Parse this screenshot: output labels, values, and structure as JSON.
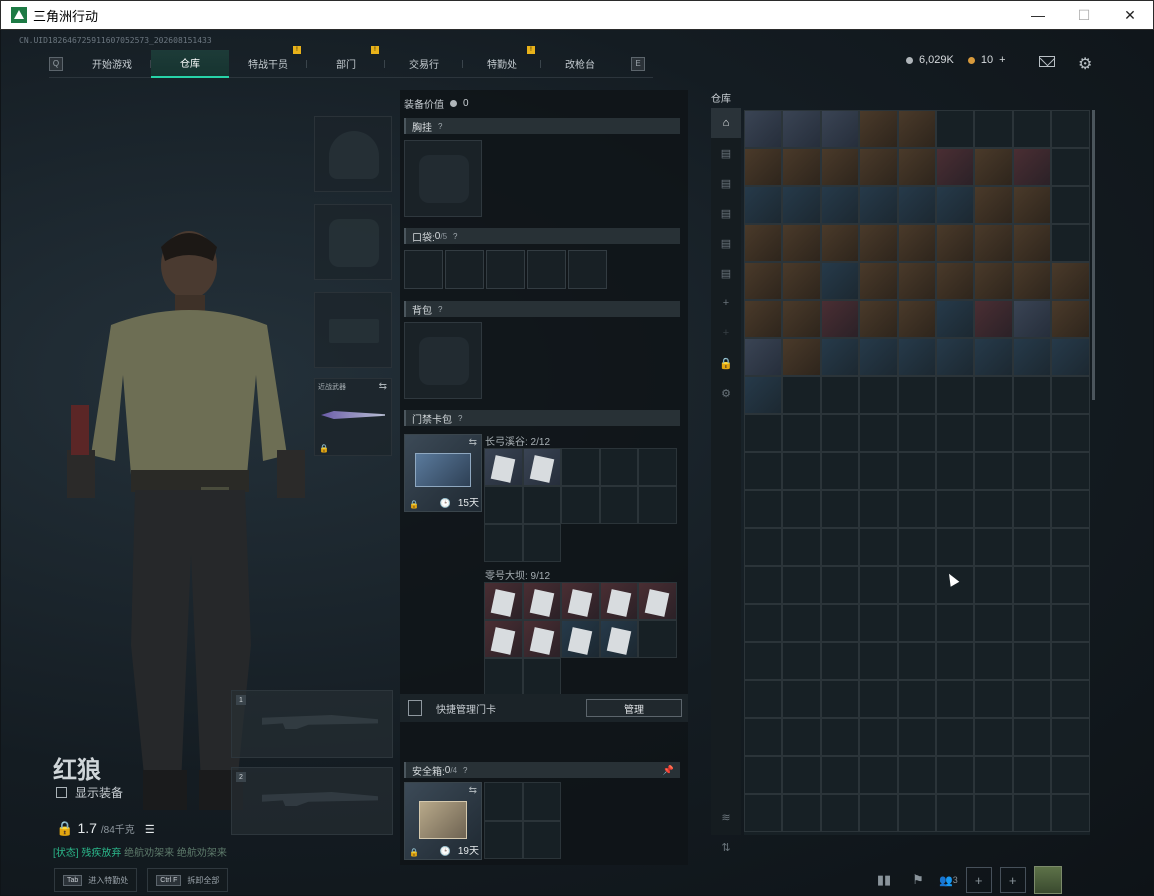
{
  "window": {
    "title": "三角洲行动",
    "minimize": "—",
    "maximize": "☐",
    "close": "✕"
  },
  "uid": "CN.UID18264672591160705257З_202608151433",
  "nav": {
    "left_key": "Q",
    "right_key": "E",
    "tabs": [
      {
        "label": "开始游戏",
        "active": false,
        "notice": false
      },
      {
        "label": "仓库",
        "active": true,
        "notice": false
      },
      {
        "label": "特战干员",
        "active": false,
        "notice": true
      },
      {
        "label": "部门",
        "active": false,
        "notice": true
      },
      {
        "label": "交易行",
        "active": false,
        "notice": false
      },
      {
        "label": "特勤处",
        "active": false,
        "notice": true
      },
      {
        "label": "改枪台",
        "active": false,
        "notice": false
      }
    ]
  },
  "currency": {
    "silver": "6,029K",
    "gold": "10",
    "gold_add": "+"
  },
  "character": {
    "name": "红狼",
    "show_equipment": "显示装备",
    "weight_current": "1.7",
    "weight_max": "/84千克",
    "status_prefix": "[状态]",
    "status_1": "残疾放弃",
    "status_2": "绝航劝架来",
    "status_3": "绝航劝架来"
  },
  "slots": {
    "melee_label": "近战武器",
    "weapon_1": "1",
    "weapon_2": "2"
  },
  "equipment": {
    "value_label": "装备价值",
    "value": "0",
    "chest_rig": "胸挂",
    "pockets": "口袋:",
    "pockets_count": "0",
    "pockets_max": "/5",
    "backpack": "背包",
    "keycard_case": "门禁卡包",
    "keycard_days": "15天",
    "changgong_label": "长弓溪谷: 2/12",
    "linghao_label": "零号大坝: 9/12",
    "quick_manage": "快捷管理门卡",
    "manage_button": "管理",
    "safe_box": "安全箱:",
    "safe_count": "0",
    "safe_max": "/4",
    "safe_days": "19天"
  },
  "stash": {
    "title": "仓库"
  },
  "bottom": {
    "hint1_key": "Tab",
    "hint1_text": "进入特勤处",
    "hint2_key": "Ctrl F",
    "hint2_text": "拆卸全部",
    "friends_count": "3"
  },
  "colors": {
    "accent": "#27d3a8",
    "notice": "#e8b21a"
  }
}
